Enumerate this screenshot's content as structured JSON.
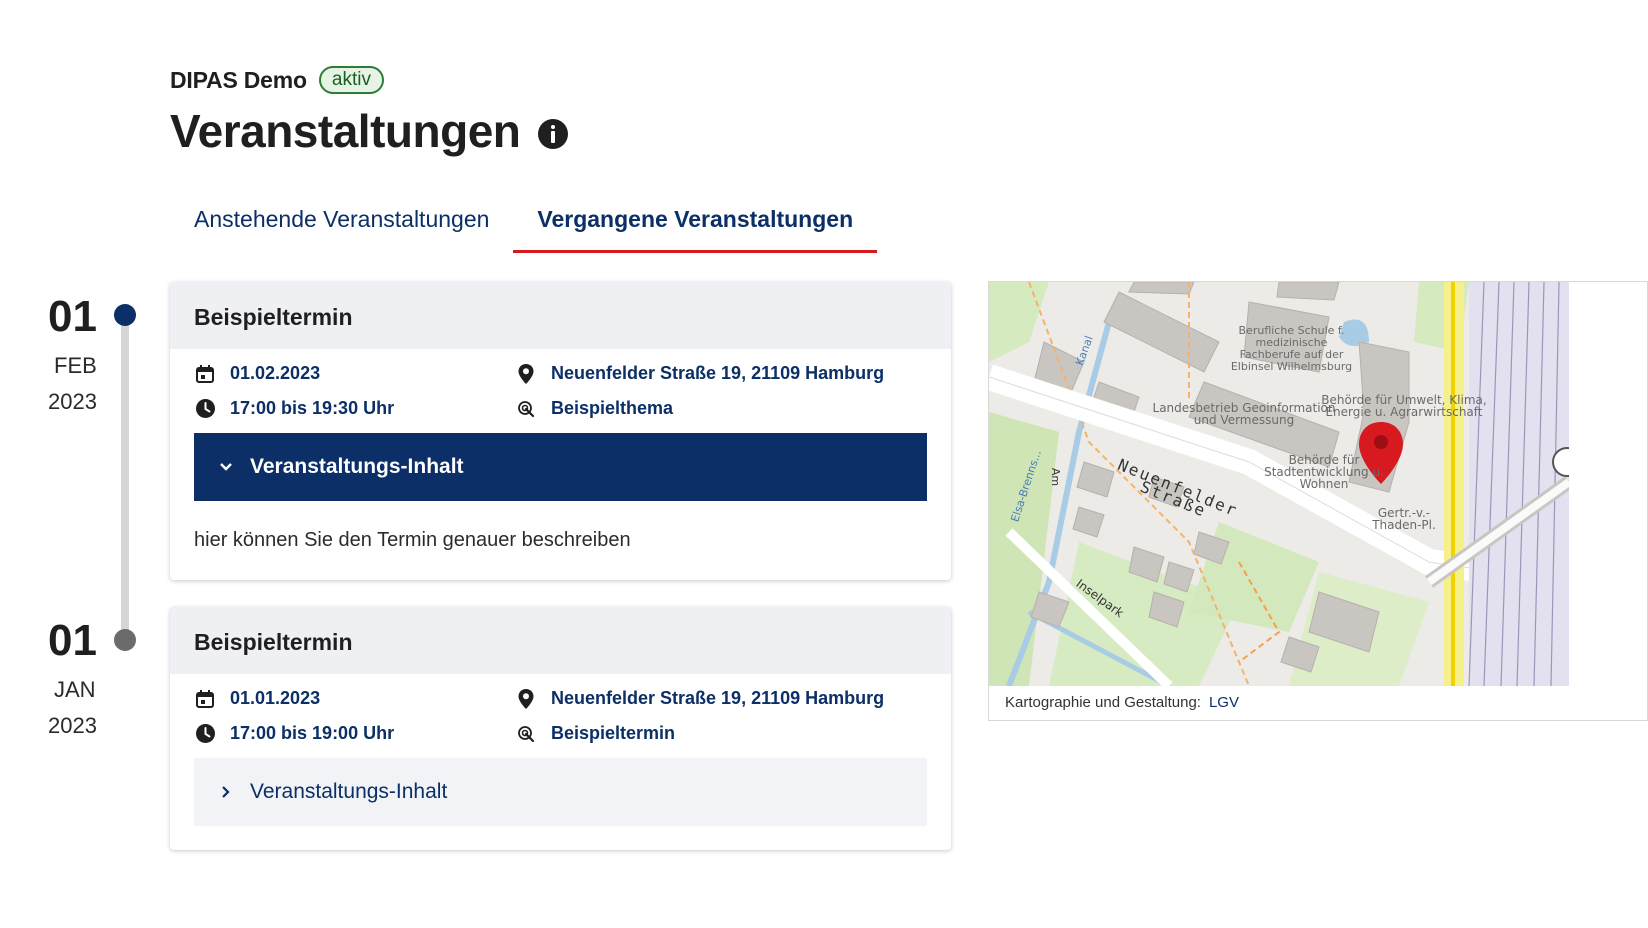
{
  "header": {
    "project_name": "DIPAS Demo",
    "status_badge": "aktiv",
    "page_title": "Veranstaltungen"
  },
  "tabs": [
    {
      "label": "Anstehende Veranstaltungen",
      "active": false
    },
    {
      "label": "Vergangene Veranstaltungen",
      "active": true
    }
  ],
  "events": [
    {
      "day": "01",
      "month": "FEB",
      "year": "2023",
      "title": "Beispieltermin",
      "date": "01.02.2023",
      "time": "17:00 bis 19:30 Uhr",
      "address": "Neuenfelder Straße 19, 21109 Hamburg",
      "topic": "Beispielthema",
      "accordion_label": "Veranstaltungs-Inhalt",
      "expanded": true,
      "description": "hier können Sie den Termin genauer beschreiben"
    },
    {
      "day": "01",
      "month": "JAN",
      "year": "2023",
      "title": "Beispieltermin",
      "date": "01.01.2023",
      "time": "17:00 bis 19:00 Uhr",
      "address": "Neuenfelder Straße 19, 21109 Hamburg",
      "topic": "Beispieltermin",
      "accordion_label": "Veranstaltungs-Inhalt",
      "expanded": false
    }
  ],
  "map": {
    "street_main": "Neuenfelder Straße",
    "street_inselpark": "Inselpark",
    "street_kanal": "Kanal",
    "street_elsa": "Elsa-Brenns...",
    "street_am": "Am",
    "poi_schule": "Berufliche Schule f. medizinische Fachberufe auf der Elbinsel Wilhelmsburg",
    "poi_landesbetrieb": "Landesbetrieb Geoinformation und Vermessung",
    "poi_umwelt": "Behörde für Umwelt, Klima, Energie u. Agrarwirtschaft",
    "poi_stadt": "Behörde für Stadtentwicklung u. Wohnen",
    "poi_gertr": "Gertr.-v.-Thaden-Pl.",
    "attribution_label": "Kartographie und Gestaltung:",
    "attribution_link": "LGV",
    "marker_color": "#d71920"
  },
  "colors": {
    "primary": "#0b2f66",
    "accent": "#d71920",
    "badge_green": "#2e7d32"
  }
}
